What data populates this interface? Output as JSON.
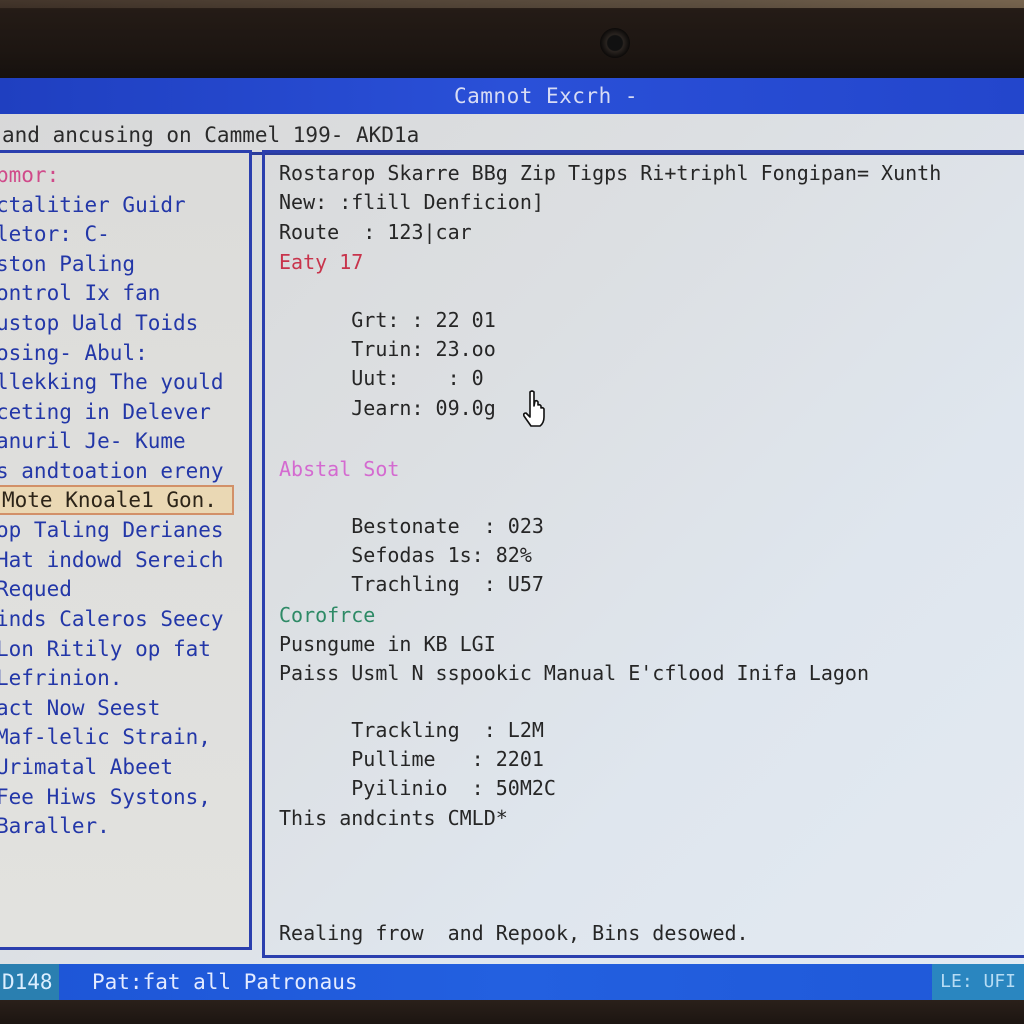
{
  "window": {
    "title": "Camnot Excrh -",
    "menu_text": "and ancusing on Cammel 199- AKD1a"
  },
  "sidebar": {
    "items": [
      {
        "label": "pmor:",
        "style": "head"
      },
      {
        "label": "ctalitier Guidr"
      },
      {
        "label": "letor: C-"
      },
      {
        "label": "ston Paling"
      },
      {
        "label": "ontrol Ix fan"
      },
      {
        "label": "ustop Uald Toids"
      },
      {
        "label": "osing- Abul:"
      },
      {
        "label": "llekking The yould"
      },
      {
        "label": "ceting in Delever"
      },
      {
        "label": "anuril Je- Kume"
      },
      {
        "label": "s andtoation ereny"
      },
      {
        "label": "Mote Knoale1 Gon.",
        "style": "sel"
      },
      {
        "label": "op Taling Derianes"
      },
      {
        "label": "Hat indowd Sereich"
      },
      {
        "label": "Requed"
      },
      {
        "label": "inds Caleros Seecy"
      },
      {
        "label": "Lon Ritily op fat"
      },
      {
        "label": "Lefrinion."
      },
      {
        "label": "act Now Seest"
      },
      {
        "label": "Maf-lelic Strain,"
      },
      {
        "label": "Urimatal Abeet"
      },
      {
        "label": "Fee Hiws Systons,"
      },
      {
        "label": "Baraller."
      }
    ]
  },
  "details": {
    "header_line": "Rostarop Skarre BBg Zip Tigps Ri+triphl Fongipan= Xunth",
    "new_line": "New: :flill Denficion]",
    "route_line": "Route  : 123|car",
    "section1": {
      "title": "Eaty 17",
      "rows": [
        {
          "label": "Grt:",
          "value": ": 22 01"
        },
        {
          "label": "Truin:",
          "value": "23.oo"
        },
        {
          "label": "Uut:",
          "value": " : 0"
        },
        {
          "label": "Jearn:",
          "value": "09.0g"
        }
      ]
    },
    "section2": {
      "title": "Abstal Sot",
      "rows": [
        {
          "label": "Bestonate",
          "value": ": 023"
        },
        {
          "label": "Sefodas 1s:",
          "value": "82%"
        },
        {
          "label": "Trachling",
          "value": ": U57"
        }
      ]
    },
    "section3": {
      "title": "Corofrce",
      "line1": "Pusngume in KB LGI",
      "line2": "Paiss Usml N sspookic Manual E'cflood Inifa Lagon",
      "rows": [
        {
          "label": "Trackling",
          "value": ": L2M"
        },
        {
          "label": "Pullime",
          "value": ": 2201"
        },
        {
          "label": "Pyilinio",
          "value": ": 50M2C"
        }
      ],
      "note": "This andcints CMLD*"
    },
    "footer_text": "Realing frow  and Repook, Bins desowed."
  },
  "statusbar": {
    "code": "D148",
    "message": "Pat:fat all Patronaus",
    "right": "LE: UFI"
  },
  "icons": {
    "cursor": "hand-pointer-icon",
    "webcam": "webcam-icon"
  }
}
